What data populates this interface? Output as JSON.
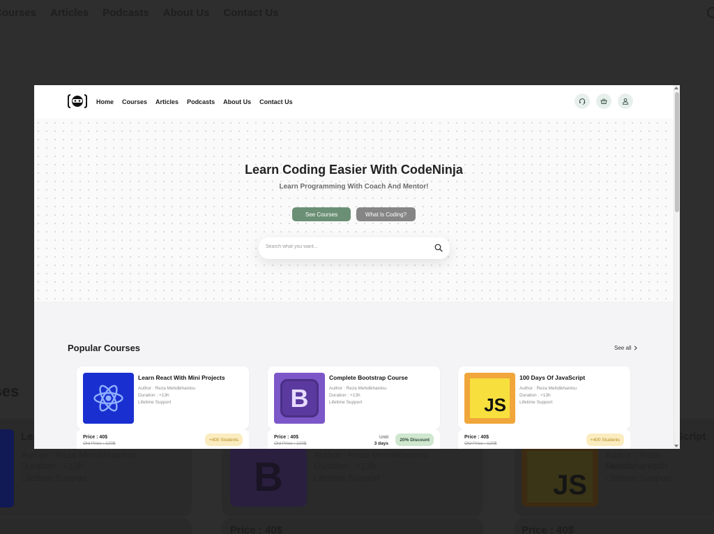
{
  "background": {
    "nav": [
      "Courses",
      "Articles",
      "Podcasts",
      "About Us",
      "Contact Us"
    ],
    "section_title": "rses",
    "card_title_fragment_1": "Lea",
    "card_title_fragment_3": "Script",
    "author": "Author : Reza Mehdikhanlou",
    "duration": "Duration : +13h",
    "support": "Lifetime Support",
    "price": "Price : 40$",
    "js_label": "JS",
    "bootstrap_label": "B"
  },
  "header": {
    "nav": [
      "Home",
      "Courses",
      "Articles",
      "Podcasts",
      "About Us",
      "Contact Us"
    ],
    "icons": [
      "headset-icon",
      "basket-icon",
      "user-icon"
    ]
  },
  "hero": {
    "title": "Learn Coding Easier With CodeNinja",
    "subtitle": "Learn Programming With Coach And Mentor!",
    "primary_button": "See Courses",
    "secondary_button": "What Is Coding?",
    "search_placeholder": "Search what you want..."
  },
  "popular": {
    "title": "Popular Courses",
    "see_all": "See all",
    "courses": [
      {
        "title": "Learn React With Mini Projects",
        "author": "Author : Reza Mehdikhanlou",
        "duration": "Duration : +13h",
        "support": "Lifetime Support",
        "price": "Price : 40$",
        "old_price": "Old Price : 120$",
        "badge": "+400 Students",
        "image": "react-logo",
        "image_color": "#1a2fd0"
      },
      {
        "title": "Complete Bootstrap Course",
        "author": "Author : Reza Mehdikhanlou",
        "duration": "Duration : +13h",
        "support": "Lifetime Support",
        "price": "Price : 40$",
        "old_price": "Old Price : 120$",
        "until_label": "Until",
        "until_value": "3 days",
        "badge": "20% Discount",
        "image": "bootstrap-logo",
        "image_letter": "B",
        "image_color": "#6b45b8"
      },
      {
        "title": "100 Days Of JavaScript",
        "author": "Author : Reza Mehdikhanlou",
        "duration": "Duration : +13h",
        "support": "Lifetime Support",
        "price": "Price : 40$",
        "old_price": "Old Price : 120$",
        "badge": "+400 Students",
        "image": "javascript-logo",
        "image_letter": "JS",
        "image_color": "#f0a63a"
      }
    ]
  },
  "colors": {
    "accent_green": "#6b8f74",
    "secondary_gray": "#858585",
    "badge_yellow_bg": "#fbecc0",
    "badge_green_bg": "#cfe6cf"
  }
}
